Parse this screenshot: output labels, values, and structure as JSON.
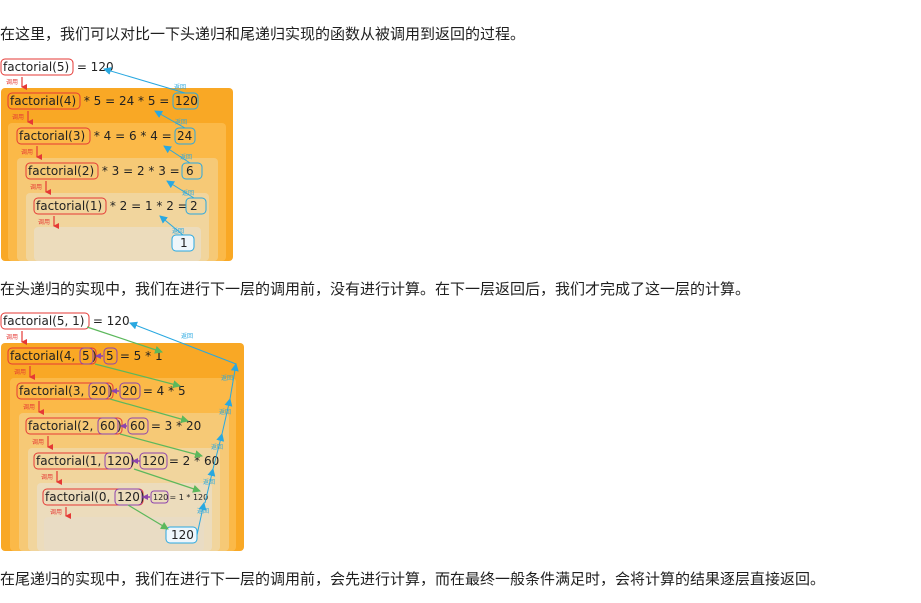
{
  "paragraphs": {
    "intro": "在这里，我们可以对比一下头递归和尾递归实现的函数从被调用到返回的过程。",
    "head_desc": "在头递归的实现中，我们在进行下一层的调用前，没有进行计算。在下一层返回后，我们才完成了这一层的计算。",
    "tail_desc": "在尾递归的实现中，我们在进行下一层的调用前，会先进行计算，而在最终一般条件满足时，会将计算的结果逐层直接返回。"
  },
  "labels": {
    "call": "调用",
    "return": "返回"
  },
  "head_recursion": {
    "levels": [
      {
        "call": "factorial(5)",
        "expr": " = 120",
        "ret": ""
      },
      {
        "call": "factorial(4)",
        "expr": " * 5 = 24 * 5 = ",
        "ret": "120"
      },
      {
        "call": "factorial(3)",
        "expr": " * 4 = 6 * 4 = ",
        "ret": "24"
      },
      {
        "call": "factorial(2)",
        "expr": " * 3 = 2 * 3 = ",
        "ret": "6"
      },
      {
        "call": "factorial(1)",
        "expr": " * 2 = 1 * 2 = ",
        "ret": "2"
      }
    ],
    "base_value": "1"
  },
  "tail_recursion": {
    "levels": [
      {
        "fn": "factorial(5, 1)",
        "eq": " = 120"
      },
      {
        "fn": "factorial(4, ",
        "acc": "5",
        "close": ")",
        "res": "5",
        "eq": " = 5 * 1"
      },
      {
        "fn": "factorial(3, ",
        "acc": "20",
        "close": ")",
        "res": "20",
        "eq": " = 4 * 5"
      },
      {
        "fn": "factorial(2, ",
        "acc": "60",
        "close": ")",
        "res": "60",
        "eq": " = 3 * 20"
      },
      {
        "fn": "factorial(1, ",
        "acc": "120",
        "close": ")",
        "res": "120",
        "eq": " = 2 * 60"
      },
      {
        "fn": "factorial(0, ",
        "acc": "120",
        "close": ")",
        "res": "120",
        "eq": " = 1 * 120"
      }
    ],
    "final_value": "120"
  },
  "colors": {
    "frame_outer": "#f9a825",
    "frame_inner": "#ecdcbc",
    "call_arrow": "#e53935",
    "return_arrow": "#29a8e0",
    "pass_arrow": "#5cb85c",
    "pass_dot": "#8e44ad"
  }
}
